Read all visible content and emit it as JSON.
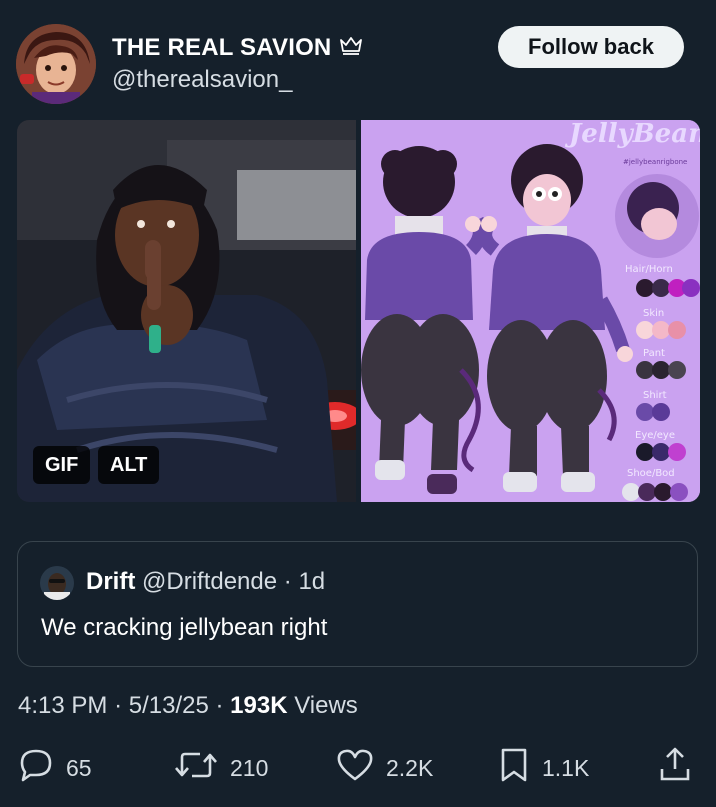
{
  "author": {
    "display_name": "THE REAL SAVION",
    "handle": "@therealsavion_",
    "badge_icon": "crown-icon"
  },
  "follow_button": {
    "label": "Follow back"
  },
  "media": {
    "badges": {
      "gif": "GIF",
      "alt": "ALT"
    },
    "right_image": {
      "watermark": "JellyBean"
    }
  },
  "quoted_post": {
    "display_name": "Drift",
    "handle": "@Driftdende",
    "separator": "·",
    "time_ago": "1d",
    "text": "We cracking jellybean right"
  },
  "post_meta": {
    "time": "4:13 PM",
    "sep1": "·",
    "date": "5/13/25",
    "sep2": "·",
    "views_count": "193K",
    "views_label": "Views"
  },
  "actions": {
    "replies": "65",
    "reposts": "210",
    "likes": "2.2K",
    "bookmarks": "1.1K"
  },
  "colors": {
    "background": "#15202b",
    "text_secondary": "#d6dde3",
    "border": "#38444d",
    "button_bg": "#eff3f4"
  }
}
